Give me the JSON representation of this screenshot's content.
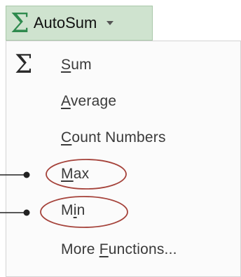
{
  "autosum": {
    "icon": "sigma-icon",
    "label": "AutoSum",
    "dropdown_icon": "dropdown-arrow-icon"
  },
  "menu": {
    "items": [
      {
        "icon": "sigma-icon",
        "prefix": "",
        "accel": "S",
        "rest": "um"
      },
      {
        "prefix": "",
        "accel": "A",
        "rest": "verage"
      },
      {
        "prefix": "",
        "accel": "C",
        "rest": "ount Numbers"
      },
      {
        "prefix": "",
        "accel": "M",
        "rest": "ax"
      },
      {
        "prefix": "M",
        "accel": "i",
        "rest": "n"
      },
      {
        "prefix": "More ",
        "accel": "F",
        "rest": "unctions..."
      }
    ]
  },
  "colors": {
    "autosum_bg": "#cfe3cf",
    "sigma_green": "#2f8a4e",
    "callout_ellipse": "#a5423a"
  }
}
